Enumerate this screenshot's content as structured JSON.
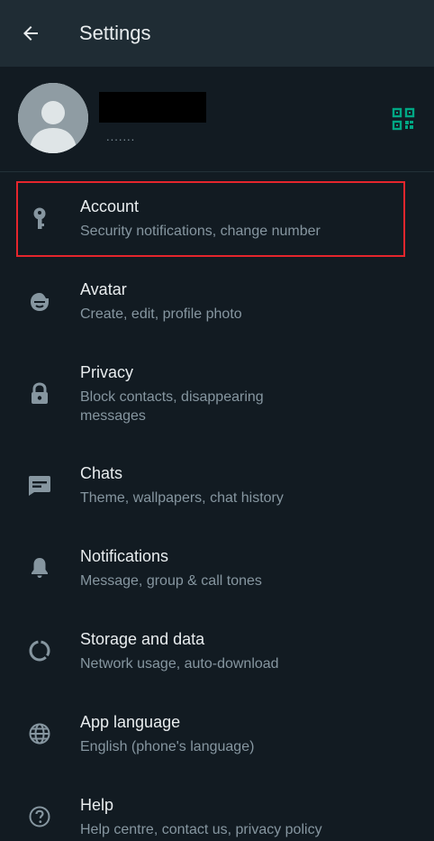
{
  "app_bar": {
    "title": "Settings",
    "back_icon": "arrow-left-icon"
  },
  "profile": {
    "about": ".......",
    "qr_icon": "qr-code-icon",
    "name_redacted": true
  },
  "settings_items": [
    {
      "id": "account",
      "title": "Account",
      "subtitle": "Security notifications, change number",
      "icon": "key-icon"
    },
    {
      "id": "avatar",
      "title": "Avatar",
      "subtitle": "Create, edit, profile photo",
      "icon": "avatar-face-icon"
    },
    {
      "id": "privacy",
      "title": "Privacy",
      "subtitle": "Block contacts, disappearing messages",
      "icon": "lock-icon"
    },
    {
      "id": "chats",
      "title": "Chats",
      "subtitle": "Theme, wallpapers, chat history",
      "icon": "chat-icon"
    },
    {
      "id": "notifications",
      "title": "Notifications",
      "subtitle": "Message, group & call tones",
      "icon": "bell-icon"
    },
    {
      "id": "storage",
      "title": "Storage and data",
      "subtitle": "Network usage, auto-download",
      "icon": "storage-circle-icon"
    },
    {
      "id": "language",
      "title": "App language",
      "subtitle": "English (phone's language)",
      "icon": "globe-icon"
    },
    {
      "id": "help",
      "title": "Help",
      "subtitle": "Help centre, contact us, privacy policy",
      "icon": "help-icon"
    }
  ],
  "colors": {
    "background": "#121b22",
    "app_bar": "#1f2c34",
    "primary_text": "#e9edef",
    "secondary_text": "#8696a0",
    "icon": "#8696a0",
    "accent": "#00a884",
    "highlight_border": "#e5262d"
  }
}
